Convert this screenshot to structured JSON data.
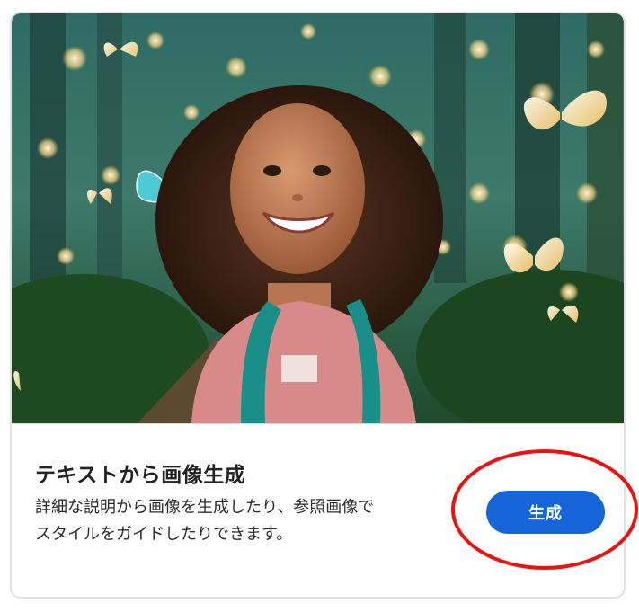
{
  "card": {
    "title": "テキストから画像生成",
    "description_line1": "詳細な説明から画像を生成したり、参照画像で",
    "description_line2": "スタイルをガイドしたりできます。",
    "button_label": "生成"
  },
  "colors": {
    "button": "#1565d8",
    "annotation_circle": "#ee1111",
    "card_border": "#e1e1e1"
  }
}
